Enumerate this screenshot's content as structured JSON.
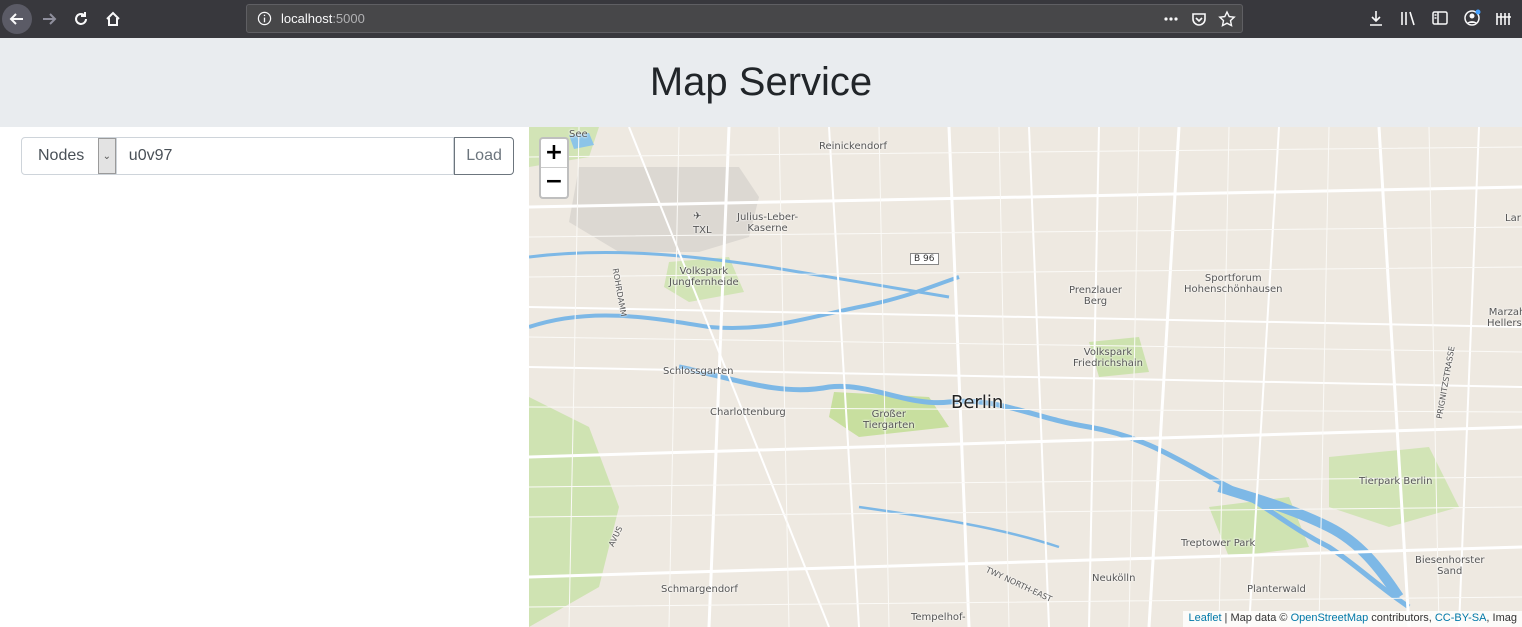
{
  "browser": {
    "url_host": "localhost",
    "url_port": ":5000"
  },
  "header": {
    "title": "Map Service"
  },
  "controls": {
    "select_value": "Nodes",
    "input_value": "u0v97",
    "load_label": "Load"
  },
  "map": {
    "zoom_in": "+",
    "zoom_out": "−",
    "attribution": {
      "leaflet": "Leaflet",
      "sep": " | Map data © ",
      "osm": "OpenStreetMap",
      "contrib": " contributors, ",
      "license": "CC-BY-SA",
      "imagery": ", Imag"
    },
    "labels": {
      "berlin": "Berlin",
      "reinickendorf": "Reinickendorf",
      "txl": "TXL",
      "julius": "Julius-Leber-\nKaserne",
      "b96": "B 96",
      "volkspark_j": "Volkspark\nJungfernheide",
      "rohrdamm": "ROHRDAMM",
      "sportforum": "Sportforum\nHohenschönhausen",
      "prenzlauer": "Prenzlauer\nBerg",
      "volkspark_f": "Volkspark\nFriedrichshain",
      "schlossgarten": "Schlossgarten",
      "charlottenburg": "Charlottenburg",
      "tiergarten": "Großer\nTiergarten",
      "tierpark": "Tierpark Berlin",
      "treptower": "Treptower Park",
      "neukoelln": "Neukölln",
      "schmargendorf": "Schmargendorf",
      "tempelhof": "Tempelhof-",
      "plantervald": "Planterwald",
      "biesenhorster": "Biesenhorster\nSand",
      "marzahn": "Marzah\nHellersc",
      "lar": "Lar",
      "prignitz": "PRIGNITZSTRASSE",
      "twy": "TWY NORTH-EAST",
      "avus": "AVUS",
      "see": "See"
    }
  }
}
